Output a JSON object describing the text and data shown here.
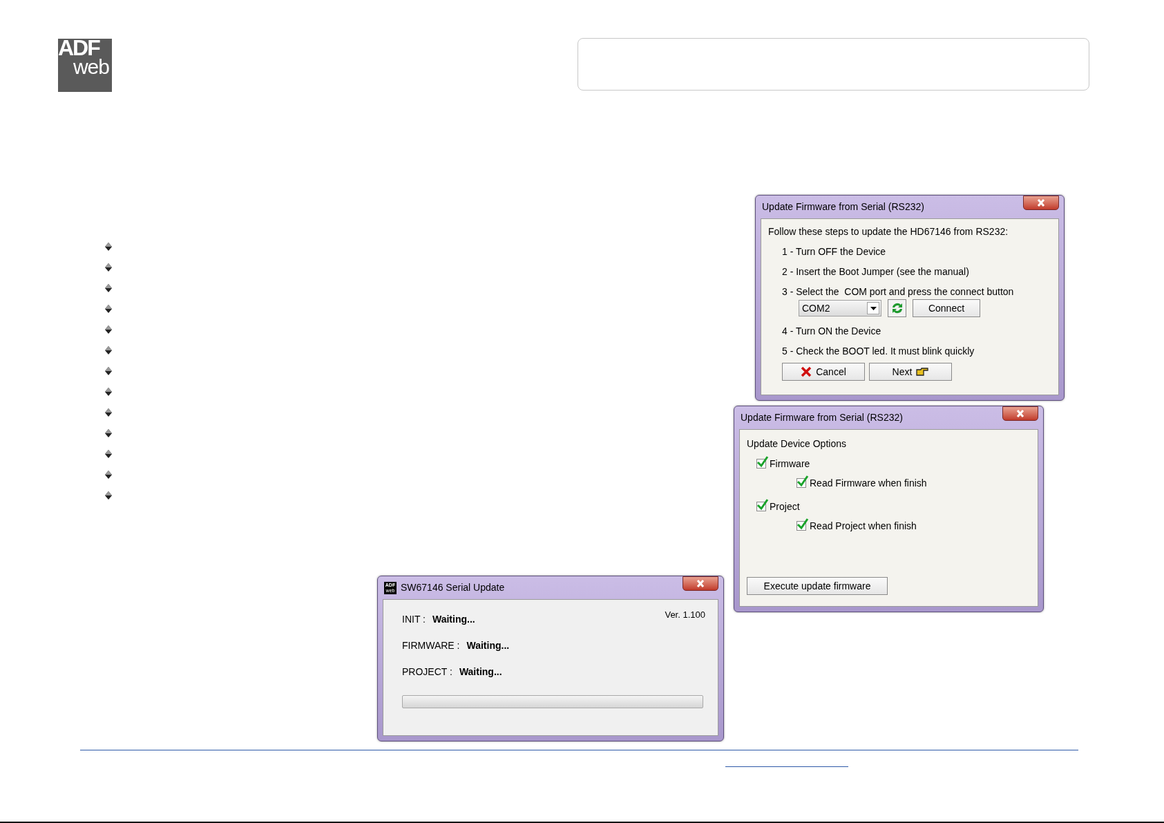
{
  "logo": {
    "top": "ADF",
    "bottom": "web"
  },
  "bullet_count_list": [
    {
      "kind": "bullet"
    },
    {
      "kind": "bullet"
    },
    {
      "kind": "bullet"
    },
    {
      "kind": "bullet"
    },
    {
      "kind": "bullet"
    },
    {
      "kind": "bullet"
    },
    {
      "kind": "bullet"
    },
    {
      "kind": "bullet"
    },
    {
      "kind": "bullet"
    },
    {
      "kind": "bullet"
    },
    {
      "kind": "bullet"
    },
    {
      "kind": "bullet"
    },
    {
      "kind": "bullet"
    }
  ],
  "connect_window": {
    "title": "Update Firmware from Serial (RS232)",
    "intro": "Follow these steps to update the HD67146 from RS232:",
    "steps_before": [
      "1 - Turn OFF the Device",
      "2 - Insert the Boot Jumper (see the manual)",
      "3 - Select the  COM port and press the connect button"
    ],
    "port_select": {
      "value": "COM2"
    },
    "connect_button": "Connect",
    "steps_after": [
      "4 - Turn ON the Device",
      "5 - Check the BOOT led. It must blink quickly"
    ],
    "cancel_button": "Cancel",
    "next_button": "Next"
  },
  "options_window": {
    "title": "Update Firmware from Serial (RS232)",
    "heading": "Update Device Options",
    "options": [
      {
        "label": "Firmware",
        "checked": true,
        "children": [
          {
            "label": "Read Firmware when finish",
            "checked": true
          }
        ]
      },
      {
        "label": "Project",
        "checked": true,
        "children": [
          {
            "label": "Read Project when finish",
            "checked": true
          }
        ]
      }
    ],
    "execute_button": "Execute update firmware"
  },
  "progress_window": {
    "title": "SW67146 Serial Update",
    "icon_text": {
      "top": "ADF",
      "bottom": "web"
    },
    "version": "Ver. 1.100",
    "statuses": [
      {
        "label": "INIT :",
        "value": "Waiting..."
      },
      {
        "label": "FIRMWARE :",
        "value": "Waiting..."
      },
      {
        "label": "PROJECT :",
        "value": "Waiting..."
      }
    ],
    "progress": {
      "level": 0
    }
  }
}
